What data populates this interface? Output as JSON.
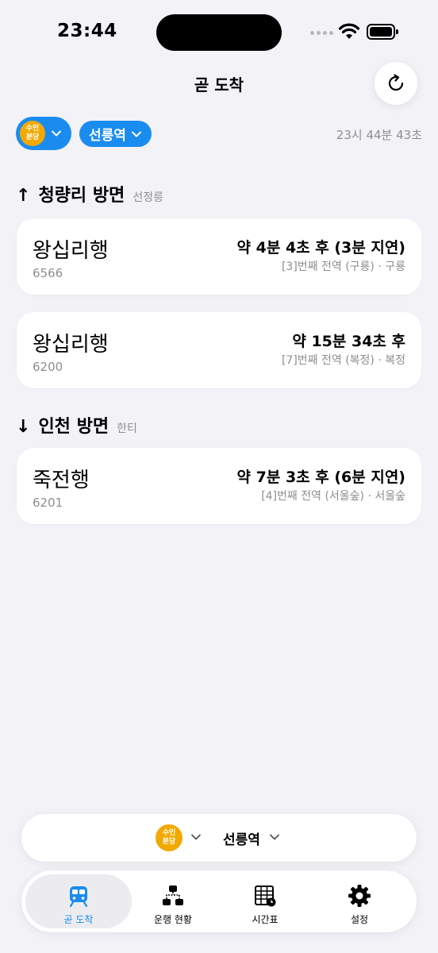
{
  "status_bar": {
    "time": "23:44"
  },
  "header": {
    "title": "곧 도착"
  },
  "selector": {
    "line_badge": [
      "수인",
      "분당"
    ],
    "station": "선릉역",
    "timestamp": "23시 44분 43초"
  },
  "directions": [
    {
      "arrow": "↑",
      "title": "청량리 방면",
      "next_station": "선정릉",
      "trains": [
        {
          "destination": "왕십리행",
          "train_no": "6566",
          "eta": "약 4분 4초 후 (3분 지연)",
          "position": "[3]번째 전역 (구룡) · 구룡"
        },
        {
          "destination": "왕십리행",
          "train_no": "6200",
          "eta": "약 15분 34초 후",
          "position": "[7]번째 전역 (복정) · 복정"
        }
      ]
    },
    {
      "arrow": "↓",
      "title": "인천 방면",
      "next_station": "한티",
      "trains": [
        {
          "destination": "죽전행",
          "train_no": "6201",
          "eta": "약 7분 3초 후 (6분 지연)",
          "position": "[4]번째 전역 (서울숲) · 서울숲"
        }
      ]
    }
  ],
  "bottom_selector": {
    "line_badge": [
      "수인",
      "분당"
    ],
    "station": "선릉역"
  },
  "tabs": [
    {
      "label": "곧 도착",
      "icon": "train-icon",
      "active": true
    },
    {
      "label": "운행 현황",
      "icon": "network-icon",
      "active": false
    },
    {
      "label": "시간표",
      "icon": "timetable-icon",
      "active": false
    },
    {
      "label": "설정",
      "icon": "gear-icon",
      "active": false
    }
  ],
  "colors": {
    "accent": "#1a8cf0",
    "line_badge": "#f2a900",
    "background": "#f2f2f7"
  }
}
